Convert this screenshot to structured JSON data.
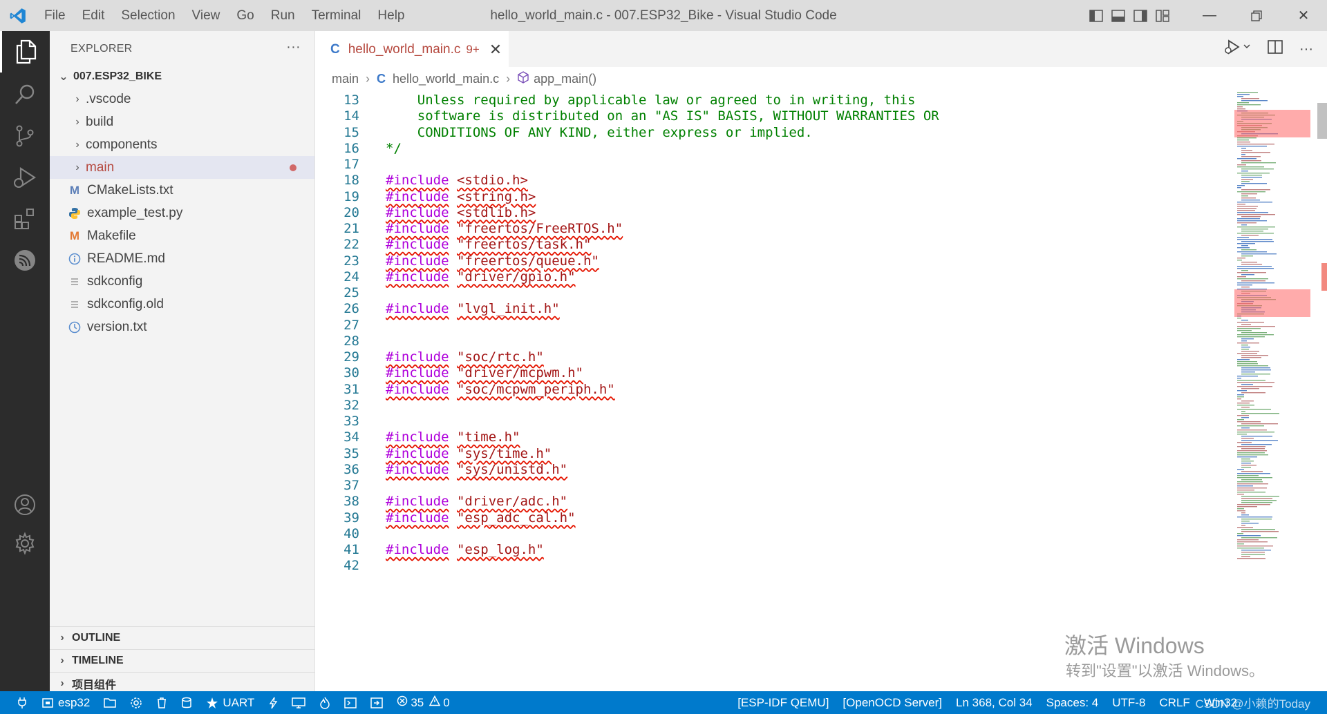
{
  "titlebar": {
    "menu": [
      "File",
      "Edit",
      "Selection",
      "View",
      "Go",
      "Run",
      "Terminal",
      "Help"
    ],
    "window_title": "hello_world_main.c - 007.ESP32_Bike - Visual Studio Code"
  },
  "activitybar": {
    "icons": [
      "explorer-icon",
      "search-icon",
      "source-control-icon",
      "run-debug-icon",
      "extensions-icon",
      "espressif-icon",
      "account-icon",
      "settings-gear-icon"
    ]
  },
  "sidebar": {
    "header": "EXPLORER",
    "more": "···",
    "folder": "007.ESP32_BIKE",
    "dirs": [
      ".vscode",
      "build",
      "components",
      "main"
    ],
    "files": [
      {
        "label": "CMakeLists.txt",
        "icon": "M"
      },
      {
        "label": "example_test.py",
        "icon": "py"
      },
      {
        "label": "Makefile",
        "icon": "M"
      },
      {
        "label": "README.md",
        "icon": "i"
      },
      {
        "label": "sdkconfig",
        "icon": "≡"
      },
      {
        "label": "sdkconfig.old",
        "icon": "≡"
      },
      {
        "label": "version.txt",
        "icon": "clock"
      }
    ],
    "panels": [
      "OUTLINE",
      "TIMELINE",
      "项目组件"
    ]
  },
  "editor": {
    "tab": {
      "name": "hello_world_main.c",
      "badge": "9+",
      "icon": "C"
    },
    "breadcrumb": {
      "folder": "main",
      "file": "hello_world_main.c",
      "symbol": "app_main()"
    },
    "lines": [
      {
        "n": "13",
        "parts": [
          {
            "t": "    Unless required by applicable law or agreed to in writing, this",
            "c": "cm"
          }
        ]
      },
      {
        "n": "14",
        "parts": [
          {
            "t": "    software is distributed on an \"AS IS\" BASIS, WITHOUT WARRANTIES OR",
            "c": "cm"
          }
        ]
      },
      {
        "n": "15",
        "parts": [
          {
            "t": "    CONDITIONS OF ANY KIND, either express or implied.",
            "c": "cm"
          }
        ]
      },
      {
        "n": "16",
        "parts": [
          {
            "t": "*/",
            "c": "cm"
          }
        ]
      },
      {
        "n": "17",
        "parts": []
      },
      {
        "n": "18",
        "parts": [
          {
            "t": "#include",
            "c": "kw"
          },
          {
            "t": " ",
            "c": ""
          },
          {
            "t": "<stdio.h>",
            "c": "str"
          }
        ]
      },
      {
        "n": "19",
        "parts": [
          {
            "t": "#include",
            "c": "kw"
          },
          {
            "t": " ",
            "c": ""
          },
          {
            "t": "<string.h>",
            "c": "str"
          }
        ]
      },
      {
        "n": "20",
        "parts": [
          {
            "t": "#include",
            "c": "kw"
          },
          {
            "t": " ",
            "c": ""
          },
          {
            "t": "<stdlib.h>",
            "c": "str"
          }
        ]
      },
      {
        "n": "21",
        "parts": [
          {
            "t": "#include",
            "c": "kw"
          },
          {
            "t": " ",
            "c": ""
          },
          {
            "t": "\"freertos/FreeRTOS.h\"",
            "c": "str"
          }
        ]
      },
      {
        "n": "22",
        "parts": [
          {
            "t": "#include",
            "c": "kw"
          },
          {
            "t": " ",
            "c": ""
          },
          {
            "t": "\"freertos/task.h\"",
            "c": "str"
          }
        ]
      },
      {
        "n": "23",
        "parts": [
          {
            "t": "#include",
            "c": "kw"
          },
          {
            "t": " ",
            "c": ""
          },
          {
            "t": "\"freertos/queue.h\"",
            "c": "str"
          }
        ]
      },
      {
        "n": "24",
        "parts": [
          {
            "t": "#include",
            "c": "kw"
          },
          {
            "t": " ",
            "c": ""
          },
          {
            "t": "\"driver/gpio.h\"",
            "c": "str"
          }
        ]
      },
      {
        "n": "25",
        "parts": []
      },
      {
        "n": "26",
        "parts": [
          {
            "t": "#include",
            "c": "kw"
          },
          {
            "t": " ",
            "c": ""
          },
          {
            "t": "\"lvgl_init.h\"",
            "c": "str"
          }
        ]
      },
      {
        "n": "27",
        "parts": []
      },
      {
        "n": "28",
        "parts": []
      },
      {
        "n": "29",
        "parts": [
          {
            "t": "#include",
            "c": "kw"
          },
          {
            "t": " ",
            "c": ""
          },
          {
            "t": "\"soc/rtc.h\"",
            "c": "str"
          }
        ]
      },
      {
        "n": "30",
        "parts": [
          {
            "t": "#include",
            "c": "kw"
          },
          {
            "t": " ",
            "c": ""
          },
          {
            "t": "\"driver/mcpwm.h\"",
            "c": "str"
          }
        ]
      },
      {
        "n": "31",
        "parts": [
          {
            "t": "#include",
            "c": "kw"
          },
          {
            "t": " ",
            "c": ""
          },
          {
            "t": "\"soc/mcpwm_periph.h\"",
            "c": "str"
          }
        ]
      },
      {
        "n": "32",
        "parts": []
      },
      {
        "n": "33",
        "parts": []
      },
      {
        "n": "34",
        "parts": [
          {
            "t": "#include",
            "c": "kw"
          },
          {
            "t": " ",
            "c": ""
          },
          {
            "t": "\"time.h\"",
            "c": "str"
          }
        ]
      },
      {
        "n": "35",
        "parts": [
          {
            "t": "#include",
            "c": "kw"
          },
          {
            "t": " ",
            "c": ""
          },
          {
            "t": "\"sys/time.h\"",
            "c": "str"
          }
        ]
      },
      {
        "n": "36",
        "parts": [
          {
            "t": "#include",
            "c": "kw"
          },
          {
            "t": " ",
            "c": ""
          },
          {
            "t": "\"sys/unistd.h\"",
            "c": "str"
          }
        ]
      },
      {
        "n": "37",
        "parts": []
      },
      {
        "n": "38",
        "parts": [
          {
            "t": "#include",
            "c": "kw"
          },
          {
            "t": " ",
            "c": ""
          },
          {
            "t": "\"driver/adc.h\"",
            "c": "str"
          }
        ]
      },
      {
        "n": "39",
        "parts": [
          {
            "t": "#include",
            "c": "kw"
          },
          {
            "t": " ",
            "c": ""
          },
          {
            "t": "\"esp_adc_cal.h\"",
            "c": "str"
          }
        ]
      },
      {
        "n": "40",
        "parts": []
      },
      {
        "n": "41",
        "parts": [
          {
            "t": "#include",
            "c": "kw"
          },
          {
            "t": " ",
            "c": ""
          },
          {
            "t": "\"esp_log.h\"",
            "c": "str"
          }
        ]
      },
      {
        "n": "42",
        "parts": []
      }
    ]
  },
  "statusbar": {
    "left": [
      {
        "name": "esp-idf-plug-item",
        "icon": "plug-icon",
        "text": ""
      },
      {
        "name": "target-item",
        "icon": "chip-icon",
        "text": "esp32"
      },
      {
        "name": "folder-item",
        "icon": "folder-icon",
        "text": ""
      },
      {
        "name": "config-item",
        "icon": "gear-icon",
        "text": ""
      },
      {
        "name": "fullclean-item",
        "icon": "trash-icon",
        "text": ""
      },
      {
        "name": "build-item",
        "icon": "cylinder-icon",
        "text": ""
      },
      {
        "name": "flash-method-item",
        "icon": "star-icon",
        "text": "UART"
      },
      {
        "name": "flash-item",
        "icon": "lightning-icon",
        "text": ""
      },
      {
        "name": "monitor-item",
        "icon": "monitor-icon",
        "text": ""
      },
      {
        "name": "build-flash-monitor-item",
        "icon": "flame-icon",
        "text": ""
      },
      {
        "name": "terminal-item",
        "icon": "terminal-icon",
        "text": ""
      },
      {
        "name": "debug-item",
        "icon": "arrow-box-icon",
        "text": ""
      }
    ],
    "problems": {
      "errors": "35",
      "warnings": "0"
    },
    "right": [
      "[ESP-IDF QEMU]",
      "[OpenOCD Server]",
      "Ln 368, Col 34",
      "Spaces: 4",
      "UTF-8",
      "CRLF",
      "Win32"
    ],
    "overlay": "CSDN @小赖的Today"
  },
  "watermark": {
    "title": "激活 Windows",
    "subtitle": "转到\"设置\"以激活 Windows。"
  }
}
